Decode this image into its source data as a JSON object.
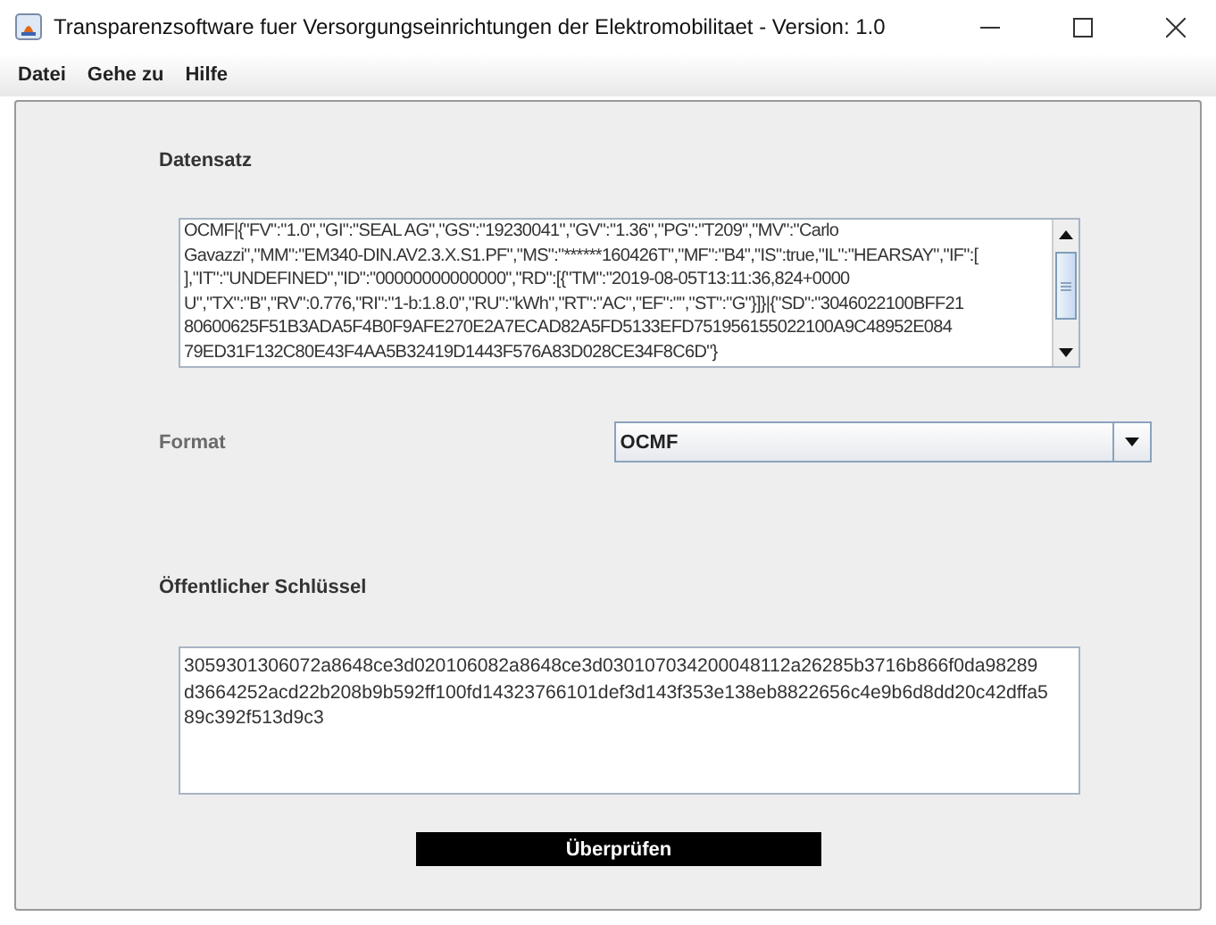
{
  "window": {
    "title": "Transparenzsoftware fuer Versorgungseinrichtungen der Elektromobilitaet - Version: 1.0"
  },
  "menu": [
    "Datei",
    "Gehe zu",
    "Hilfe"
  ],
  "dataset": {
    "label": "Datensatz",
    "lines": [
      "OCMF|{\"FV\":\"1.0\",\"GI\":\"SEAL AG\",\"GS\":\"19230041\",\"GV\":\"1.36\",\"PG\":\"T209\",\"MV\":\"Carlo",
      "Gavazzi\",\"MM\":\"EM340-DIN.AV2.3.X.S1.PF\",\"MS\":\"******160426T\",\"MF\":\"B4\",\"IS\":true,\"IL\":\"HEARSAY\",\"IF\":[",
      "],\"IT\":\"UNDEFINED\",\"ID\":\"00000000000000\",\"RD\":[{\"TM\":\"2019-08-05T13:11:36,824+0000",
      "U\",\"TX\":\"B\",\"RV\":0.776,\"RI\":\"1-b:1.8.0\",\"RU\":\"kWh\",\"RT\":\"AC\",\"EF\":\"\",\"ST\":\"G\"}]}|{\"SD\":\"3046022100BFF21",
      "80600625F51B3ADA5F4B0F9AFE270E2A7ECAD82A5FD5133EFD751956155022100A9C48952E084",
      "79ED31F132C80E43F4AA5B32419D1443F576A83D028CE34F8C6D\"}"
    ]
  },
  "format": {
    "label": "Format",
    "value": "OCMF"
  },
  "public_key": {
    "label": "Öffentlicher Schlüssel",
    "lines": [
      "3059301306072a8648ce3d020106082a8648ce3d030107034200048112a26285b3716b866f0da98289",
      "d3664252acd22b208b9b592ff100fd14323766101def3d143f353e138eb8822656c4e9b6d8dd20c42dffa5",
      "89c392f513d9c3"
    ]
  },
  "verify_button": "Überprüfen"
}
